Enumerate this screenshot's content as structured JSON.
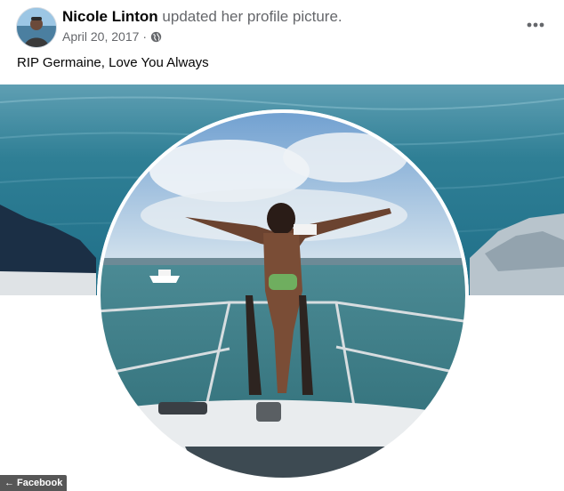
{
  "post": {
    "author_name": "Nicole Linton",
    "action_text": "updated her profile picture.",
    "date": "April 20, 2017",
    "separator": "·",
    "privacy_icon": "globe-icon",
    "more_icon": "more-options-icon",
    "caption": "RIP Germaine, Love You Always"
  },
  "watermark": {
    "arrow": "←",
    "label": "Facebook"
  },
  "colors": {
    "name": "#050505",
    "meta": "#65676b",
    "sea": "#2f7f95",
    "sky": "#9fc3e2"
  }
}
